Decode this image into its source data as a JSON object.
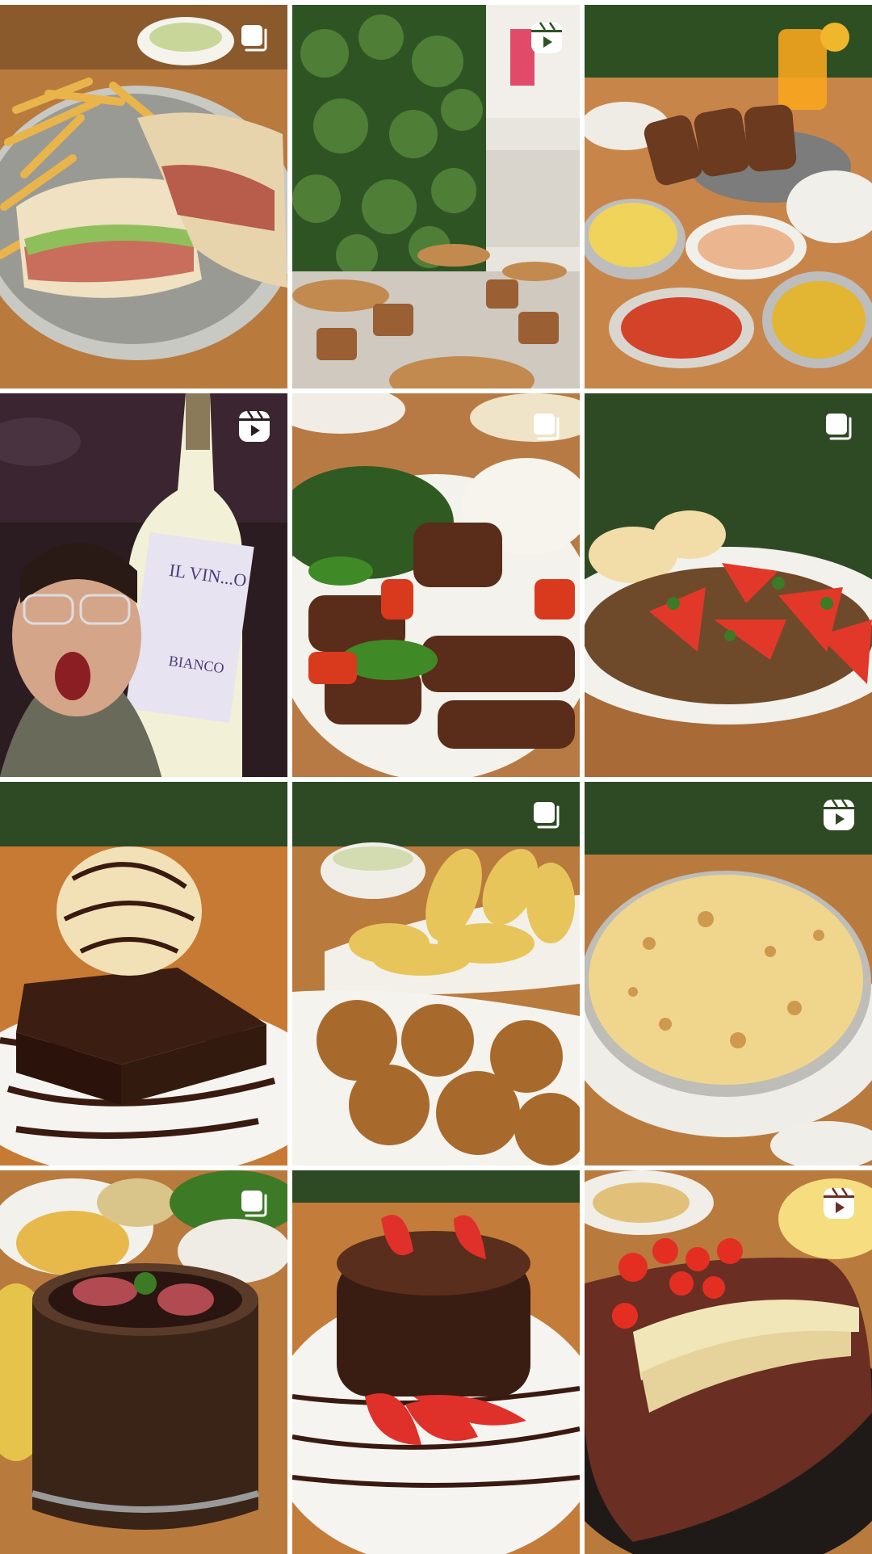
{
  "grid": {
    "tiles": [
      {
        "subject": "sandwich-and-fries",
        "badge": "carousel-icon"
      },
      {
        "subject": "restaurant-interior",
        "badge": "reel-icon"
      },
      {
        "subject": "feast-table",
        "badge": "none"
      },
      {
        "subject": "wine-bottle-reel",
        "badge": "reel-icon",
        "bottle_label": [
          "IL VIN...O",
          "BIANCO"
        ]
      },
      {
        "subject": "beef-with-peppers",
        "badge": "carousel-icon"
      },
      {
        "subject": "ground-beef-tomato",
        "badge": "carousel-icon"
      },
      {
        "subject": "brownie-ice-cream",
        "badge": "none"
      },
      {
        "subject": "fried-snacks",
        "badge": "carousel-icon"
      },
      {
        "subject": "cheese-gratin",
        "badge": "reel-icon"
      },
      {
        "subject": "feijoada-pot",
        "badge": "carousel-icon"
      },
      {
        "subject": "chocolate-strawberry-cake",
        "badge": "none"
      },
      {
        "subject": "steak-and-banana",
        "badge": "reel-icon"
      }
    ]
  },
  "colors": {
    "wood": "#b9793c",
    "plate": "#f4f1ea",
    "foliage": "#2f5a24",
    "beef": "#5a2b1a",
    "tomato": "#d93a28",
    "chocolate": "#3a1d12",
    "cheese": "#f2d892",
    "badge": "#ffffff"
  }
}
